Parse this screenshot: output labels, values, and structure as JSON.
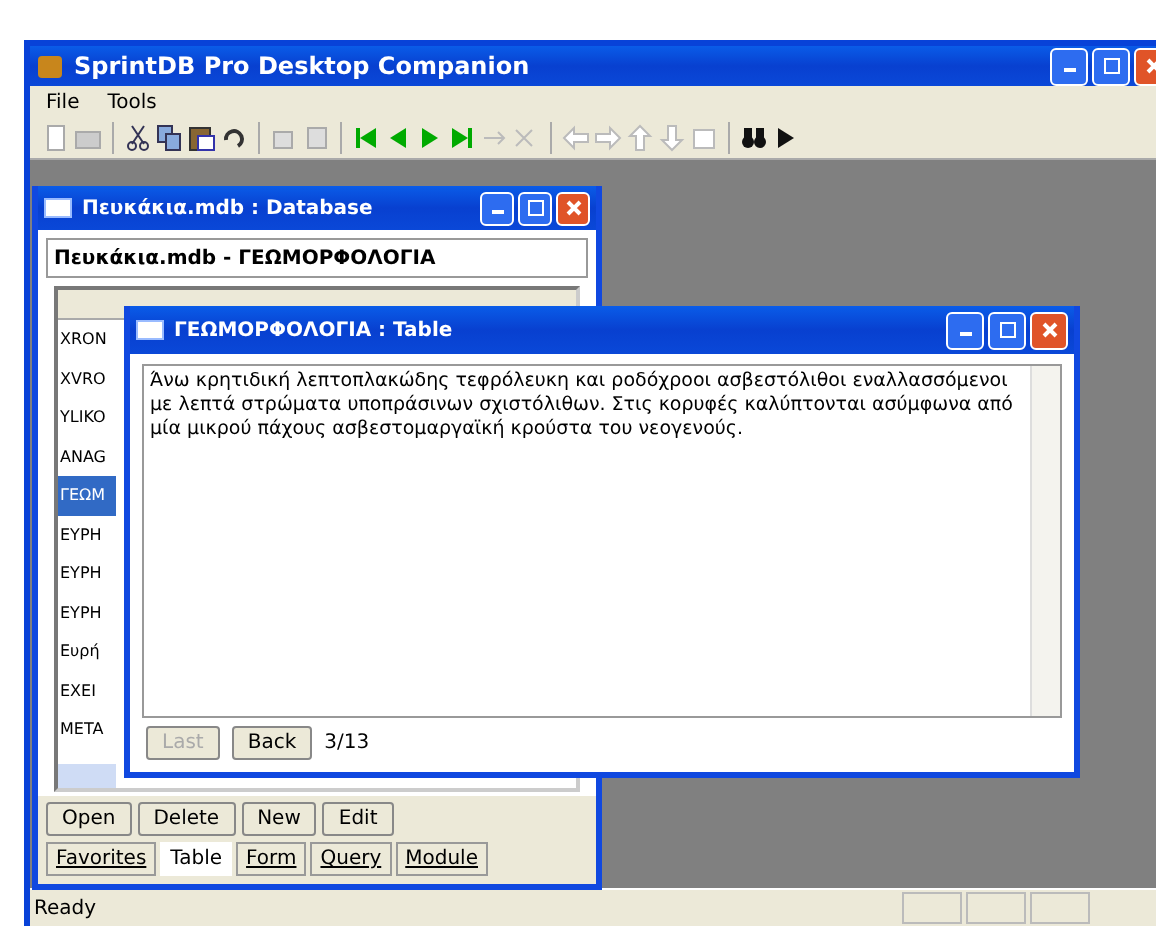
{
  "window": {
    "title": "SprintDB Pro Desktop Companion"
  },
  "menu": [
    "File",
    "Tools"
  ],
  "database_window": {
    "title": "Πευκάκια.mdb : Database",
    "header": "Πευκάκια.mdb - ΓΕΩΜΟΡΦΟΛΟΓΙΑ",
    "items": [
      {
        "label": "XRON",
        "selected": false
      },
      {
        "label": "XVRO",
        "selected": false
      },
      {
        "label": "YLIKO",
        "selected": false
      },
      {
        "label": "ANAG",
        "selected": false
      },
      {
        "label": "ΓΕΩΜ",
        "selected": true
      },
      {
        "label": "ΕΥΡΗ",
        "selected": false
      },
      {
        "label": "ΕΥΡΗ",
        "selected": false
      },
      {
        "label": "ΕΥΡΗ",
        "selected": false
      },
      {
        "label": "Ευρή",
        "selected": false
      },
      {
        "label": "EXEI",
        "selected": false
      },
      {
        "label": "META",
        "selected": false
      }
    ],
    "buttons": [
      "Open",
      "Delete",
      "New",
      "Edit"
    ],
    "tabs": [
      {
        "label": "Favorites",
        "selected": false
      },
      {
        "label": "Table",
        "selected": true
      },
      {
        "label": "Form",
        "selected": false
      },
      {
        "label": "Query",
        "selected": false
      },
      {
        "label": "Module",
        "selected": false
      }
    ]
  },
  "table_window": {
    "title": "ΓΕΩΜΟΡΦΟΛΟΓΙΑ : Table",
    "value": "Άνω κρητιδική λεπτοπλακώδης τεφρόλευκη και ροδόχροοι ασβεστόλιθοι εναλλασσόμενοι με λεπτά στρώματα υποπράσινων σχιστόλιθων. Στις κορυφές καλύπτονται ασύμφωνα από μία μικρού πάχους ασβεστομαργαϊκή κρούστα του νεογενούς.",
    "nav_buttons": [
      {
        "label": "Last",
        "disabled": true
      },
      {
        "label": "Back",
        "disabled": false
      }
    ],
    "position": "3/13"
  },
  "status_bar": {
    "text": "Ready"
  }
}
